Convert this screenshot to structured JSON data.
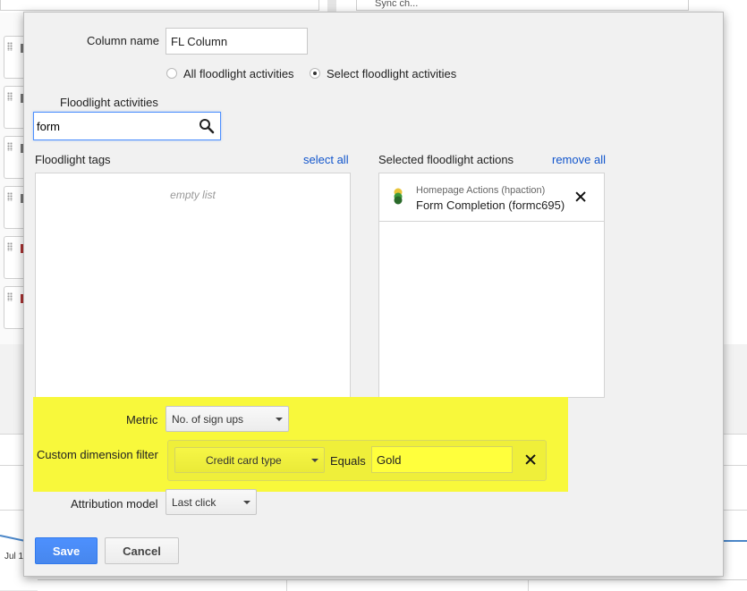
{
  "background": {
    "top_right_text": "Sync ch...",
    "chart_axis_label": "Jul 1"
  },
  "dialog": {
    "column_name_label": "Column name",
    "column_name_value": "FL Column",
    "radio_all_label": "All floodlight activities",
    "radio_select_label": "Select floodlight activities",
    "radio_selected": "select",
    "floodlight_activities_label": "Floodlight activities",
    "search_value": "form",
    "search_icon": "magnifier-icon",
    "floodlight_tags": {
      "header": "Floodlight tags",
      "select_all_link": "select all",
      "empty_text": "empty list"
    },
    "selected_actions": {
      "header": "Selected floodlight actions",
      "remove_all_link": "remove all",
      "items": [
        {
          "group": "Homepage Actions (hpaction)",
          "name": "Form Completion (formc695)",
          "icon_colors": [
            "#e8c43a",
            "#3c9a3c",
            "#2a6a2a"
          ]
        }
      ]
    },
    "metric": {
      "label": "Metric",
      "value": "No. of sign ups"
    },
    "custom_dimension_filter": {
      "label": "Custom dimension filter",
      "dimension": "Credit card type",
      "operator": "Equals",
      "value": "Gold"
    },
    "attribution_model": {
      "label": "Attribution model",
      "value": "Last click"
    },
    "highlight_color": "#f8f83b",
    "buttons": {
      "save": "Save",
      "cancel": "Cancel"
    }
  }
}
